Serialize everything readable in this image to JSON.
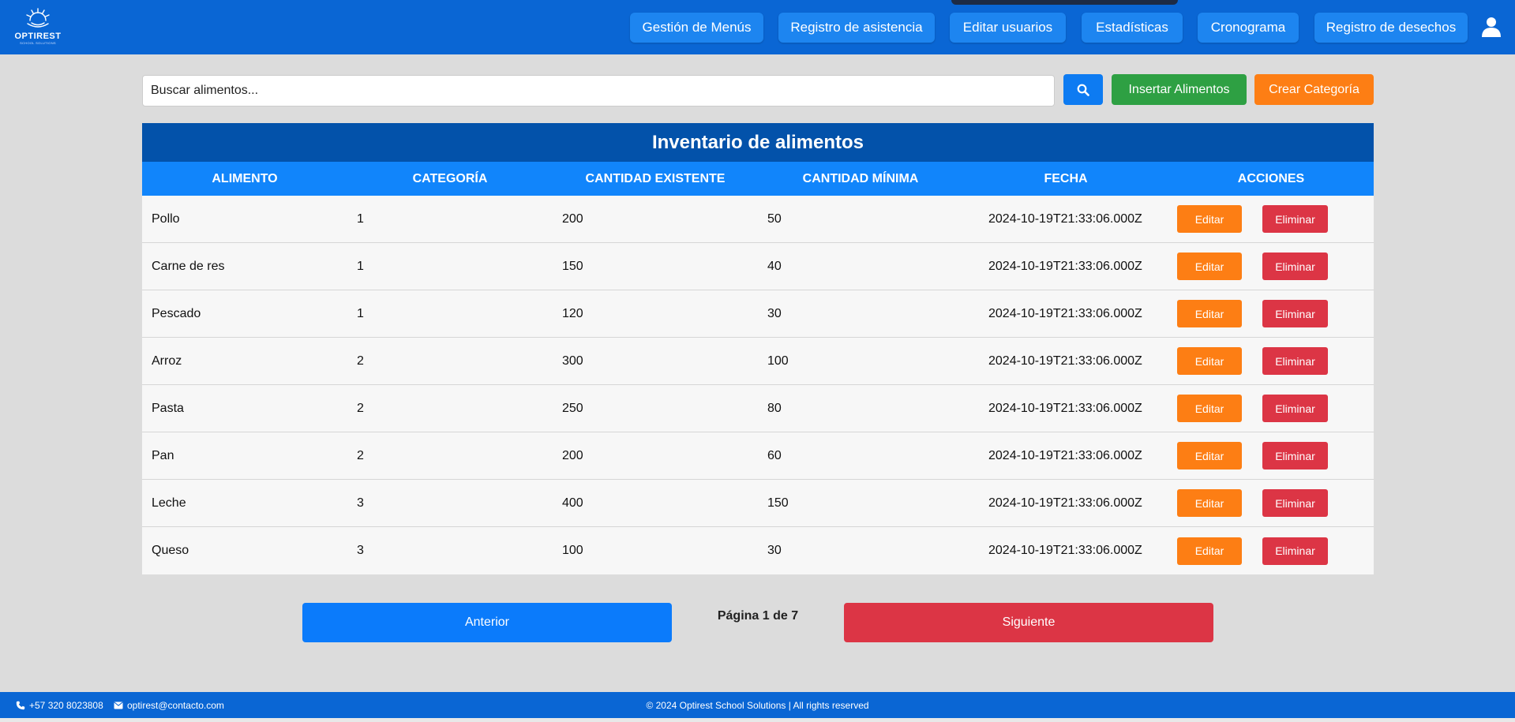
{
  "header": {
    "logo_text": "OPTIREST",
    "logo_subtext": "SCHOOL SOLUTIONS",
    "nav": [
      {
        "label": "Gestión de Menús"
      },
      {
        "label": "Registro de asistencia"
      },
      {
        "label": "Editar usuarios"
      },
      {
        "label": "Estadísticas"
      },
      {
        "label": "Cronograma"
      },
      {
        "label": "Registro de desechos"
      }
    ],
    "user_icon": "user-icon"
  },
  "toolbar": {
    "search_placeholder": "Buscar alimentos...",
    "search_icon": "search-icon",
    "insert_label": "Insertar Alimentos",
    "create_category_label": "Crear Categoría"
  },
  "table": {
    "title": "Inventario de alimentos",
    "columns": [
      "ALIMENTO",
      "CATEGORÍA",
      "CANTIDAD EXISTENTE",
      "CANTIDAD MÍNIMA",
      "FECHA",
      "ACCIONES"
    ],
    "rows": [
      {
        "alimento": "Pollo",
        "categoria": "1",
        "existente": "200",
        "minima": "50",
        "fecha": "2024-10-19T21:33:06.000Z"
      },
      {
        "alimento": "Carne de res",
        "categoria": "1",
        "existente": "150",
        "minima": "40",
        "fecha": "2024-10-19T21:33:06.000Z"
      },
      {
        "alimento": "Pescado",
        "categoria": "1",
        "existente": "120",
        "minima": "30",
        "fecha": "2024-10-19T21:33:06.000Z"
      },
      {
        "alimento": "Arroz",
        "categoria": "2",
        "existente": "300",
        "minima": "100",
        "fecha": "2024-10-19T21:33:06.000Z"
      },
      {
        "alimento": "Pasta",
        "categoria": "2",
        "existente": "250",
        "minima": "80",
        "fecha": "2024-10-19T21:33:06.000Z"
      },
      {
        "alimento": "Pan",
        "categoria": "2",
        "existente": "200",
        "minima": "60",
        "fecha": "2024-10-19T21:33:06.000Z"
      },
      {
        "alimento": "Leche",
        "categoria": "3",
        "existente": "400",
        "minima": "150",
        "fecha": "2024-10-19T21:33:06.000Z"
      },
      {
        "alimento": "Queso",
        "categoria": "3",
        "existente": "100",
        "minima": "30",
        "fecha": "2024-10-19T21:33:06.000Z"
      }
    ],
    "edit_label": "Editar",
    "delete_label": "Eliminar"
  },
  "pagination": {
    "prev_label": "Anterior",
    "page_info": "Página 1 de 7",
    "next_label": "Siguiente"
  },
  "footer": {
    "phone": "+57 320 8023808",
    "email": "optirest@contacto.com",
    "copyright": "© 2024 Optirest School Solutions | All rights reserved"
  },
  "colors": {
    "primary": "#0a66d4",
    "table_header": "#1185fb",
    "table_title": "#0352aa",
    "orange": "#fd7e14",
    "red": "#dc3545",
    "green": "#2ea043"
  }
}
